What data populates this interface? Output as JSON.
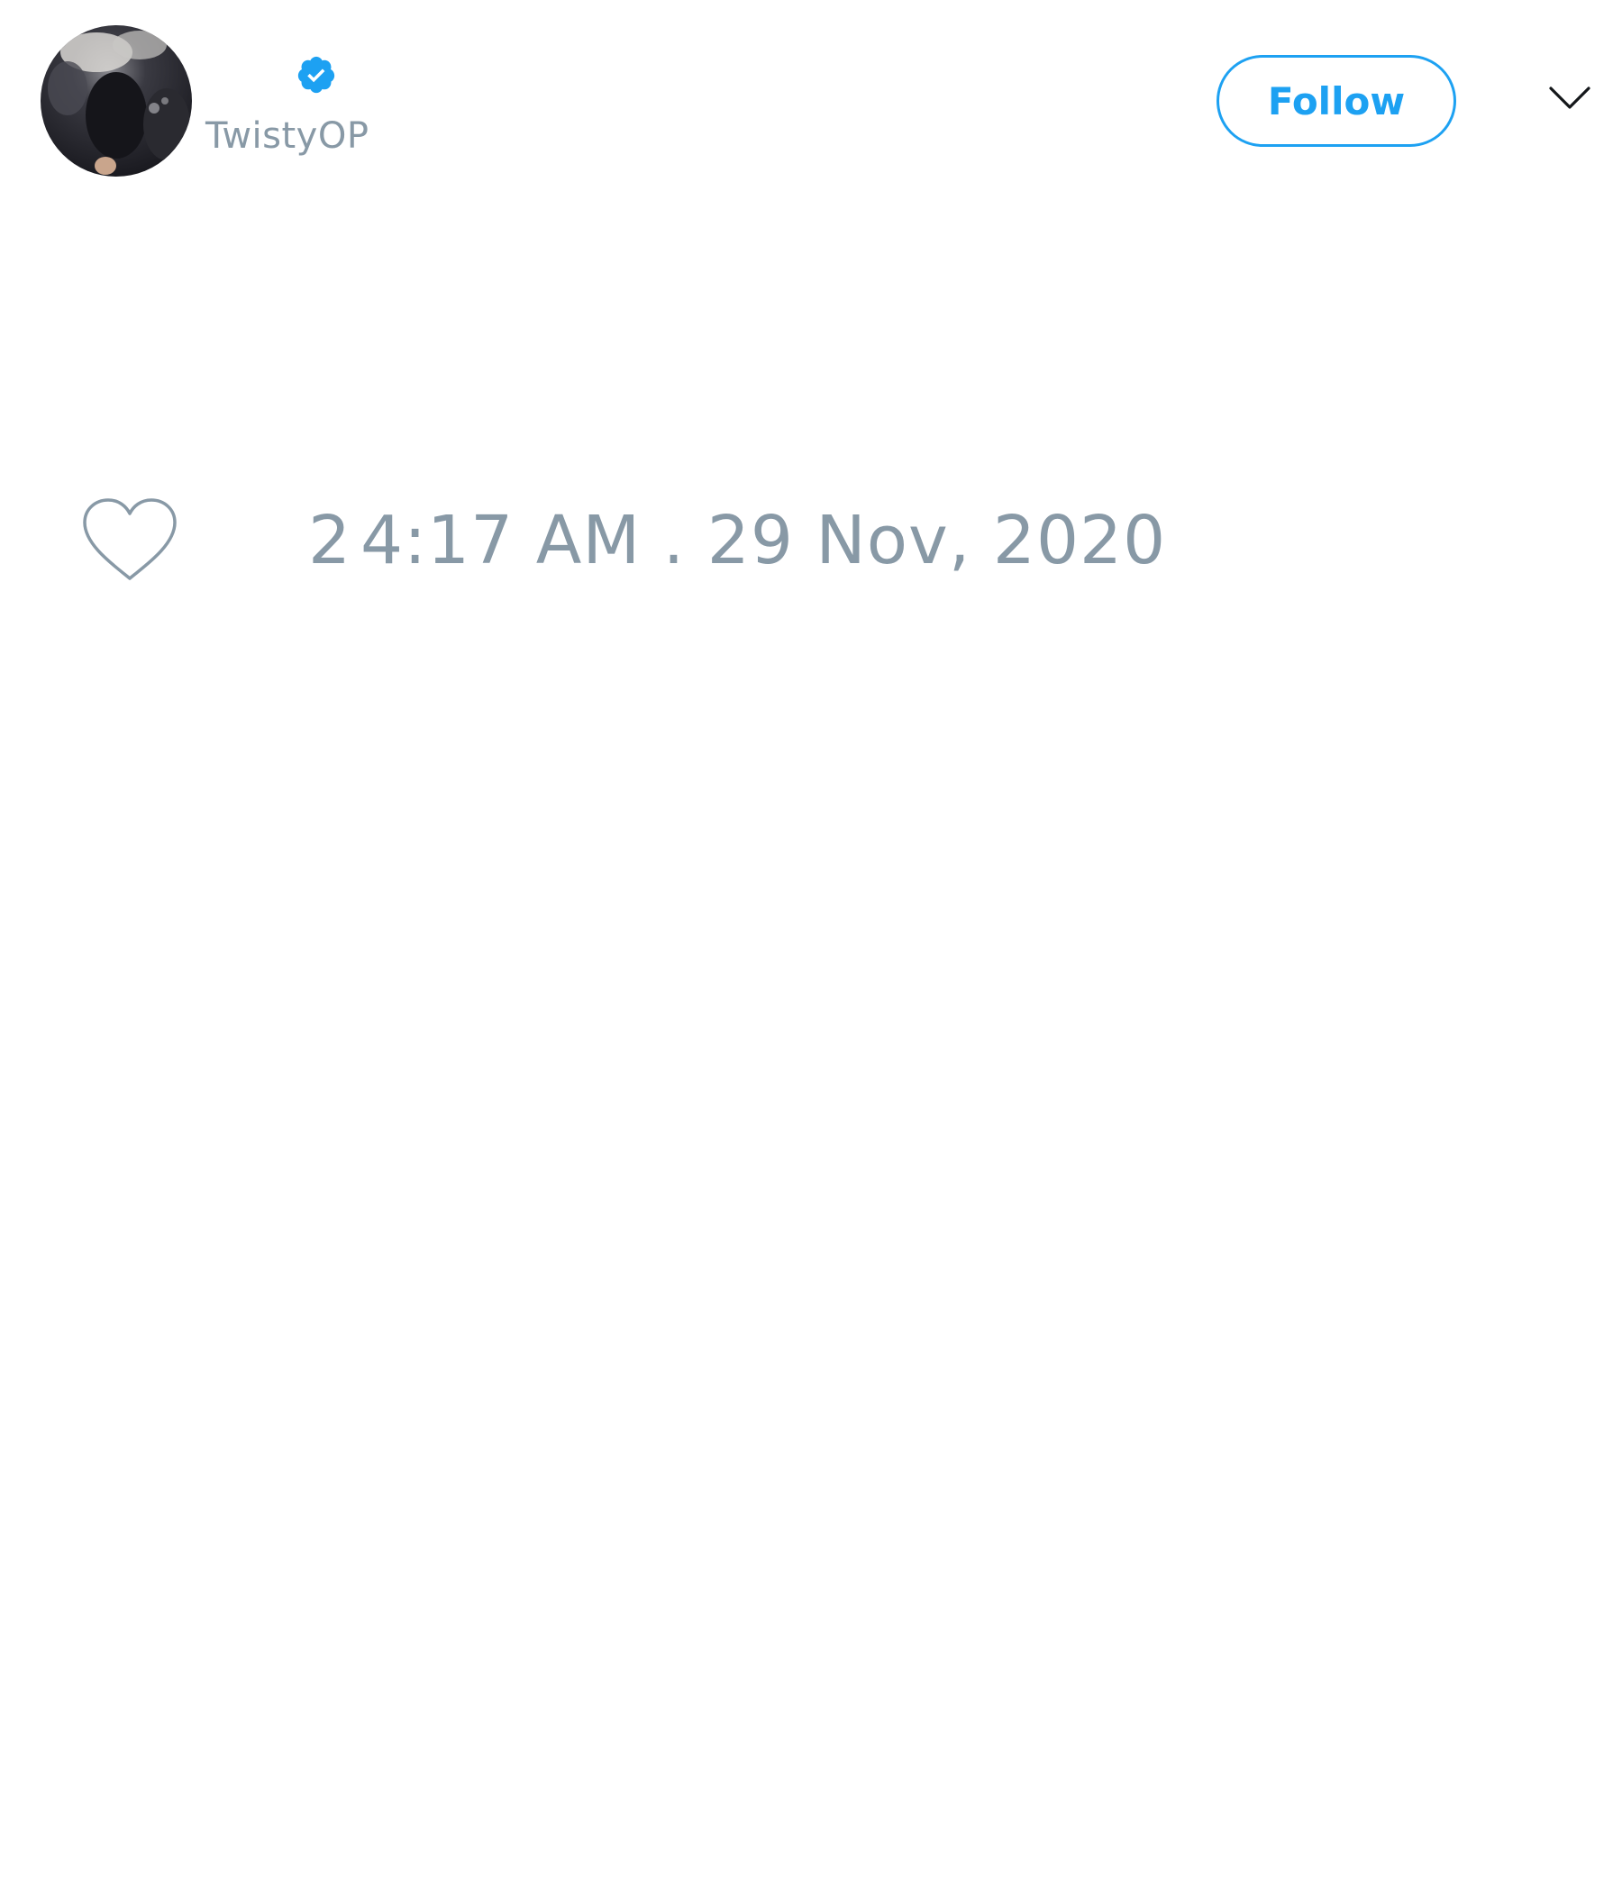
{
  "tweet": {
    "author": {
      "display_name": "",
      "handle": "TwistyOP",
      "verified": true,
      "avatar_icon": "profile-photo"
    },
    "follow_label": "Follow",
    "more_icon": "chevron-down-icon",
    "likes": {
      "icon": "heart-icon",
      "count": "2"
    },
    "timestamp": "4:17 AM . 29 Nov, 2020"
  },
  "colors": {
    "accent": "#1da1f2",
    "muted_text": "#8899a6",
    "background": "#ffffff"
  }
}
